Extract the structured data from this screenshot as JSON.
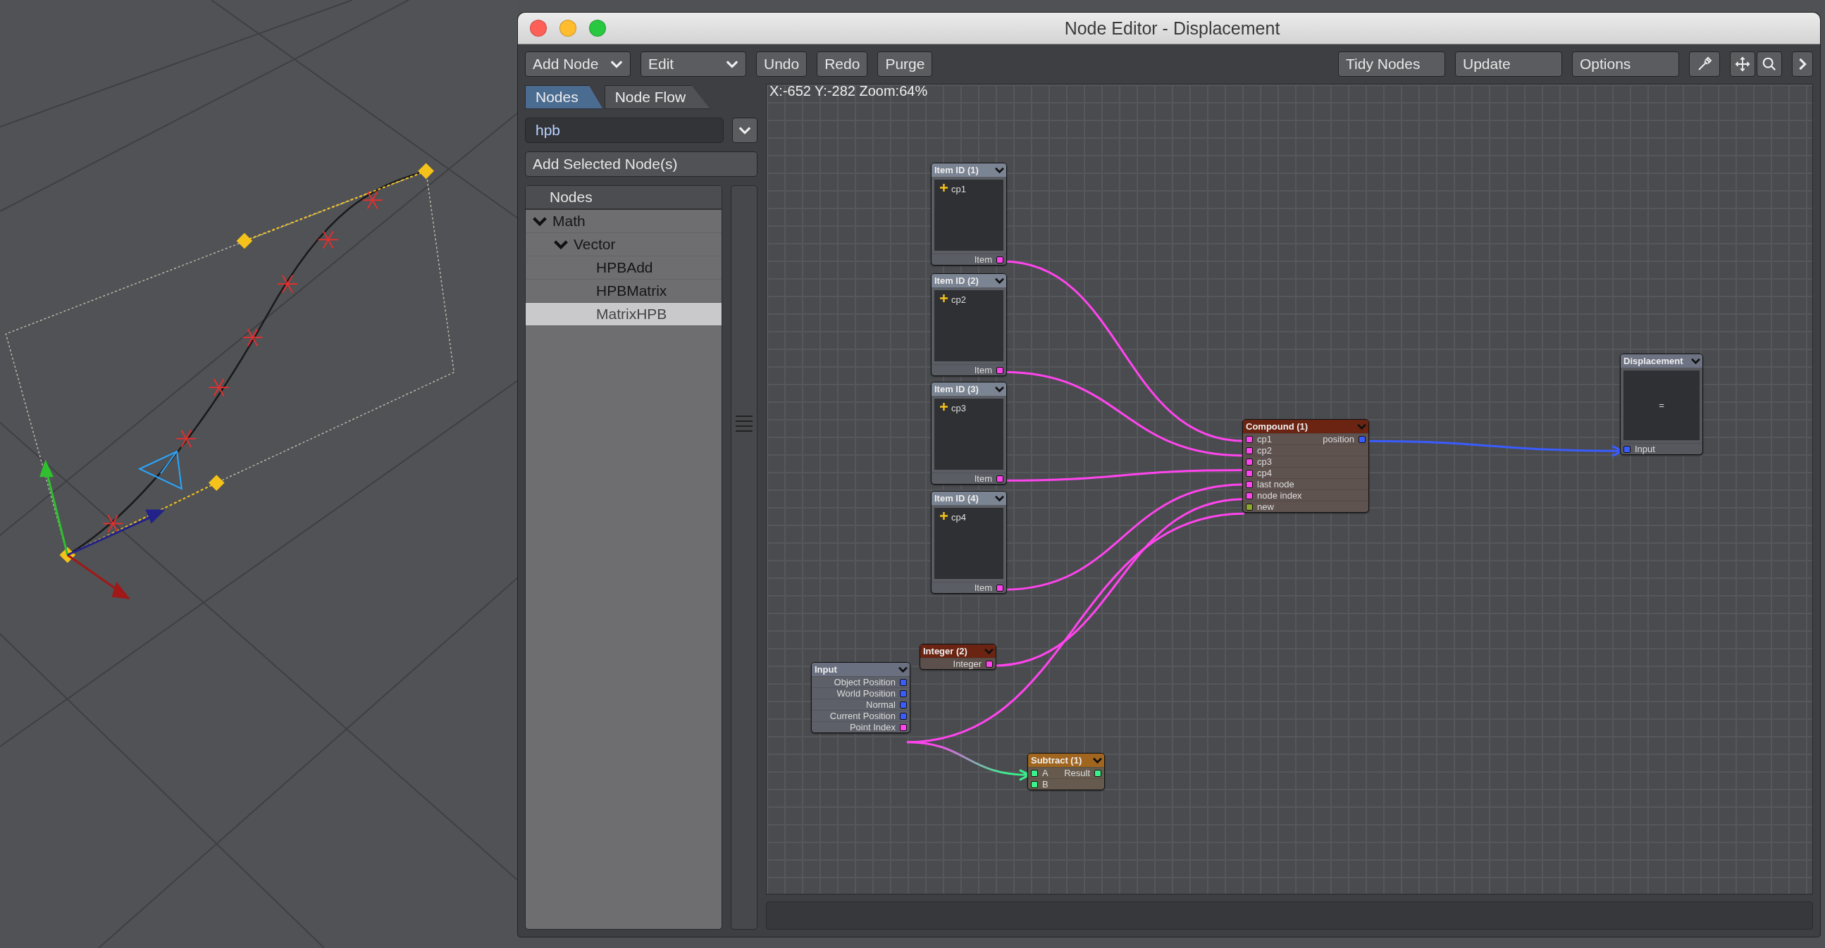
{
  "window": {
    "title": "Node Editor - Displacement"
  },
  "toolbar": {
    "left": [
      {
        "label": "Add Node",
        "kind": "dropdown"
      },
      {
        "label": "Edit",
        "kind": "dropdown"
      },
      {
        "label": "Undo",
        "kind": "button"
      },
      {
        "label": "Redo",
        "kind": "button"
      },
      {
        "label": "Purge",
        "kind": "button"
      }
    ],
    "right": [
      {
        "label": "Tidy Nodes",
        "kind": "wide"
      },
      {
        "label": "Update",
        "kind": "wide"
      },
      {
        "label": "Options",
        "kind": "wide"
      }
    ]
  },
  "sidebar": {
    "tabs": [
      {
        "label": "Nodes",
        "selected": true
      },
      {
        "label": "Node Flow",
        "selected": false
      }
    ],
    "search": {
      "value": "hpb"
    },
    "add_button": "Add Selected Node(s)",
    "tree": {
      "header": "Nodes",
      "items": [
        {
          "label": "Math",
          "expanded": true,
          "selected": false,
          "children": [
            {
              "label": "Vector",
              "expanded": true,
              "selected": false,
              "children": [
                {
                  "label": "HPBAdd",
                  "selected": false
                },
                {
                  "label": "HPBMatrix",
                  "selected": false
                },
                {
                  "label": "MatrixHPB",
                  "selected": true
                }
              ]
            }
          ]
        }
      ]
    }
  },
  "canvas": {
    "status": "X:-652 Y:-282 Zoom:64%",
    "nodes": [
      {
        "title": "Item ID (1)",
        "kind": "item",
        "color": "#7b8493",
        "preview": "cp1",
        "rows": [
          {
            "right": {
              "label": "Item",
              "color": "#ff44ee"
            }
          }
        ]
      },
      {
        "title": "Item ID (2)",
        "kind": "item",
        "color": "#7b8493",
        "preview": "cp2",
        "rows": [
          {
            "right": {
              "label": "Item",
              "color": "#ff44ee"
            }
          }
        ]
      },
      {
        "title": "Item ID (3)",
        "kind": "item",
        "color": "#7b8493",
        "preview": "cp3",
        "rows": [
          {
            "right": {
              "label": "Item",
              "color": "#ff44ee"
            }
          }
        ]
      },
      {
        "title": "Item ID (4)",
        "kind": "item",
        "color": "#7b8493",
        "preview": "cp4",
        "rows": [
          {
            "right": {
              "label": "Item",
              "color": "#ff44ee"
            }
          }
        ]
      },
      {
        "title": "Compound (1)",
        "kind": "compound",
        "color": "#6b2412",
        "rows": [
          {
            "left": {
              "label": "cp1",
              "color": "#ff44ee"
            },
            "right": {
              "label": "position",
              "color": "#3a5cff"
            }
          },
          {
            "left": {
              "label": "cp2",
              "color": "#ff44ee"
            }
          },
          {
            "left": {
              "label": "cp3",
              "color": "#ff44ee"
            }
          },
          {
            "left": {
              "label": "cp4",
              "color": "#ff44ee"
            }
          },
          {
            "left": {
              "label": "last node",
              "color": "#ff44ee"
            }
          },
          {
            "left": {
              "label": "node index",
              "color": "#ff44ee"
            }
          },
          {
            "left": {
              "label": "new",
              "color": "#8aa82a"
            }
          }
        ]
      },
      {
        "title": "Displacement",
        "kind": "output",
        "color": "#6e7384",
        "preview": "=",
        "rows": [
          {
            "left": {
              "label": "Input",
              "color": "#3a5cff"
            }
          }
        ]
      },
      {
        "title": "Integer (2)",
        "kind": "integer",
        "color": "#6b2412",
        "rows": [
          {
            "right": {
              "label": "Integer",
              "color": "#ff44ee"
            }
          }
        ]
      },
      {
        "title": "Input",
        "kind": "input",
        "color": "#6a7080",
        "rows": [
          {
            "right": {
              "label": "Object Position",
              "color": "#3a5cff"
            }
          },
          {
            "right": {
              "label": "World Position",
              "color": "#3a5cff"
            }
          },
          {
            "right": {
              "label": "Normal",
              "color": "#3a5cff"
            }
          },
          {
            "right": {
              "label": "Current Position",
              "color": "#3a5cff"
            }
          },
          {
            "right": {
              "label": "Point Index",
              "color": "#ff44ee"
            }
          }
        ]
      },
      {
        "title": "Subtract (1)",
        "kind": "math",
        "color": "#a0651e",
        "rows": [
          {
            "left": {
              "label": "A",
              "color": "#3cf08c"
            },
            "right": {
              "label": "Result",
              "color": "#3cf08c"
            }
          },
          {
            "left": {
              "label": "B",
              "color": "#3cf08c"
            }
          }
        ]
      }
    ]
  }
}
